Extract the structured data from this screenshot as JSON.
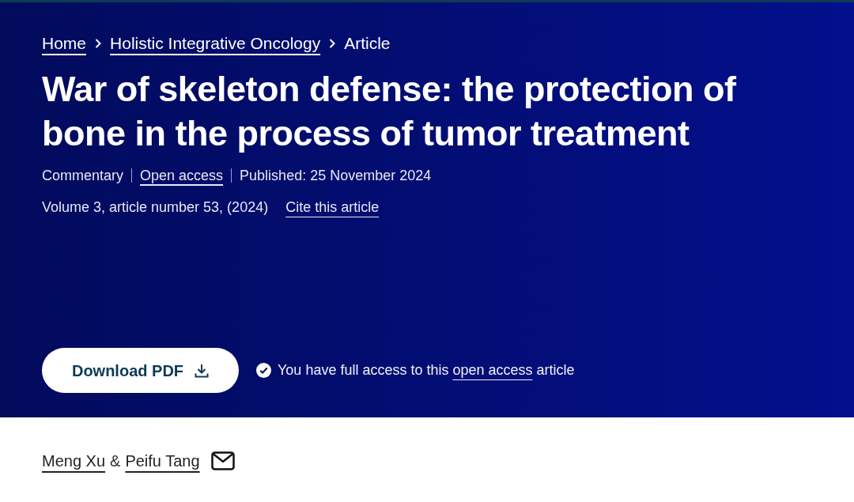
{
  "breadcrumbs": [
    {
      "label": "Home",
      "link": true
    },
    {
      "label": "Holistic Integrative Oncology",
      "link": true
    },
    {
      "label": "Article",
      "link": false
    }
  ],
  "title": "War of skeleton defense: the protection of bone in the process of tumor treatment",
  "meta": [
    {
      "label": "Commentary",
      "link": false
    },
    {
      "label": "Open access",
      "link": true
    },
    {
      "label": "Published: 25 November 2024",
      "link": false
    }
  ],
  "citation": {
    "text": "Volume 3, article number 53, (2024)",
    "cite_link": "Cite this article"
  },
  "download_button": "Download PDF",
  "access_note": {
    "before": "You have full access to this",
    "link": "open access",
    "after": "article"
  },
  "authors": [
    {
      "name": "Meng Xu"
    },
    {
      "name": "Peifu Tang"
    }
  ],
  "author_joiner": "&"
}
